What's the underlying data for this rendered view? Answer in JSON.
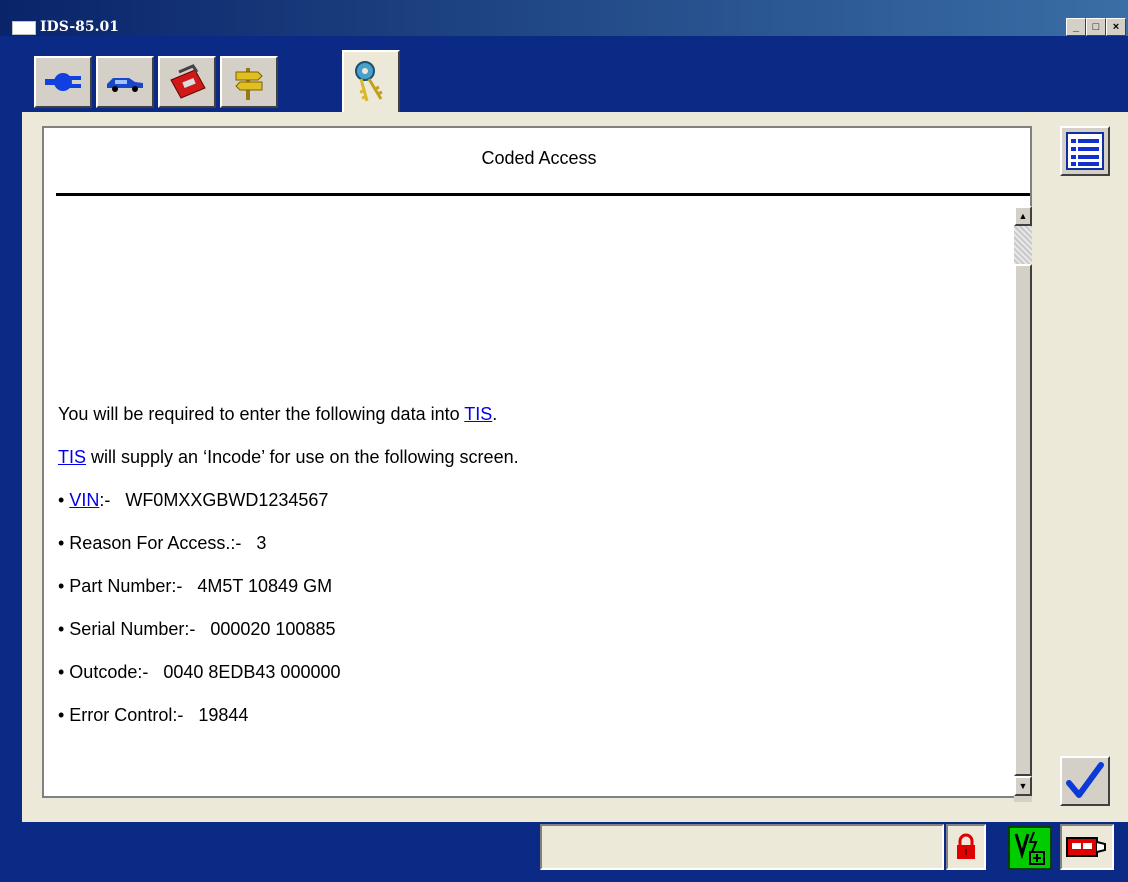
{
  "window": {
    "title": "IDS-85.01",
    "buttons": [
      "minimize",
      "maximize",
      "close"
    ]
  },
  "tabs": [
    {
      "icon": "connector-icon",
      "active": false
    },
    {
      "icon": "vehicle-icon",
      "active": false
    },
    {
      "icon": "toolbox-icon",
      "active": false
    },
    {
      "icon": "signpost-icon",
      "active": false
    },
    {
      "icon": "keys-icon",
      "active": true
    }
  ],
  "panel": {
    "title": "Coded Access",
    "intro_line1_text": "You will be required to enter the following data into ",
    "intro_line1_link": "TIS",
    "intro_line1_end": ".",
    "intro_line2_link": "TIS",
    "intro_line2_text": " will supply an ‘Incode’ for use on the following screen.",
    "vin_link": "VIN",
    "vin_value": ":-   WF0MXXGBWD1234567",
    "items": [
      "• Reason For Access.:-   3",
      "• Part Number:-   4M5T 10849 GM",
      "• Serial Number:-   000020 100885",
      "• Outcode:-   0040 8EDB43 000000",
      "• Error Control:-   19844"
    ]
  },
  "side_buttons": {
    "list": "list-icon",
    "confirm": "checkmark-icon"
  },
  "status": {
    "field_text": "",
    "icons": [
      "padlock-icon",
      "vehicle-battery-icon",
      "vci-connector-icon"
    ]
  },
  "colors": {
    "window_blue": "#0a2a86",
    "panel_bg": "#ffffff",
    "frame_bg": "#ece9d8",
    "link": "#0000ee",
    "lock_red": "#e00000",
    "battery_green": "#00cc00"
  }
}
